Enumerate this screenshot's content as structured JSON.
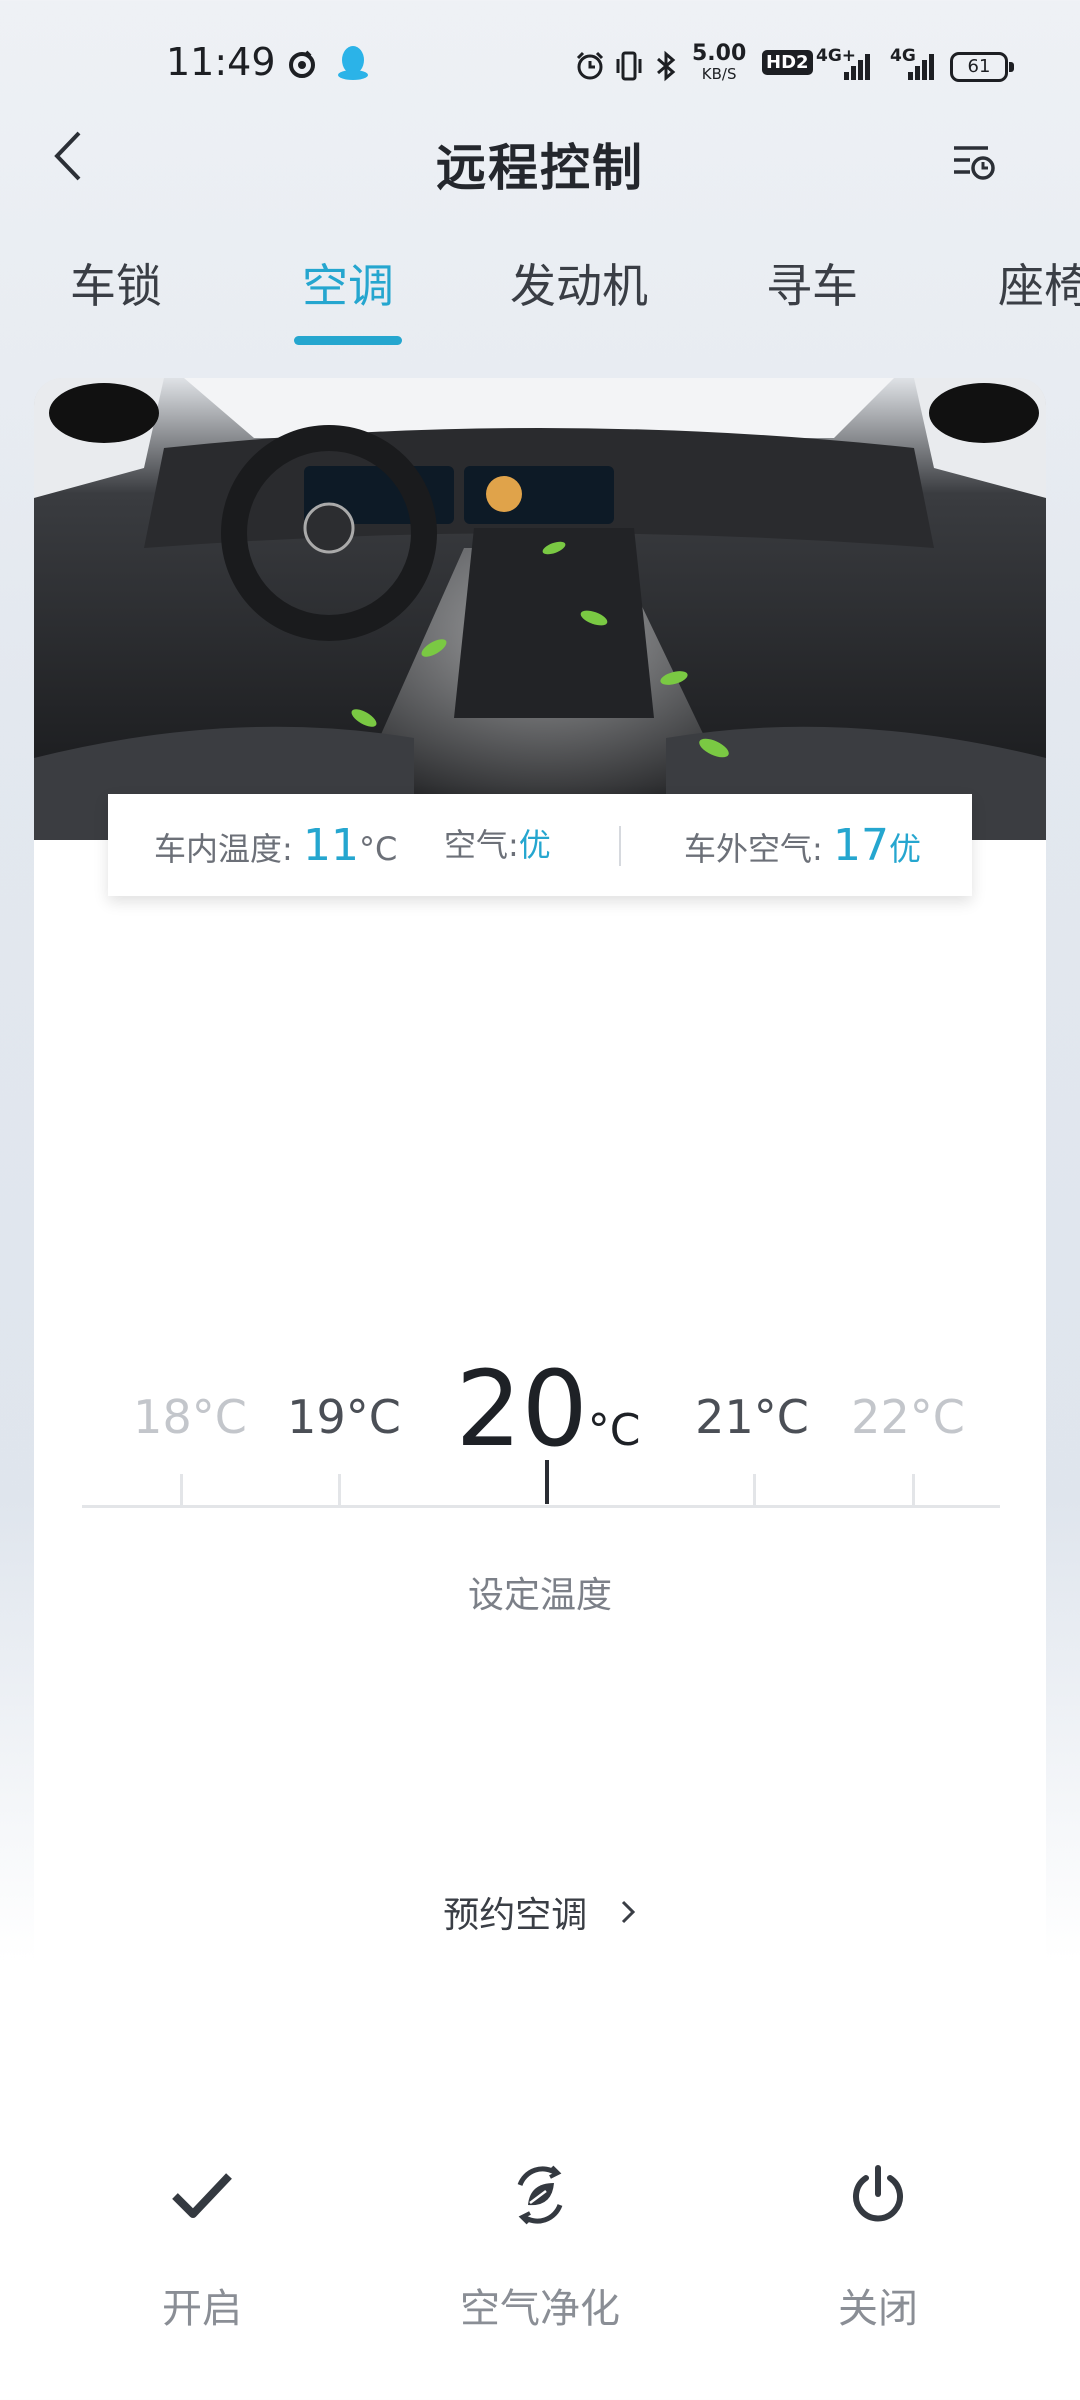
{
  "status_bar": {
    "time": "11:49",
    "net_speed": "5.00",
    "net_speed_unit": "KB/S",
    "hd_badge": "HD2",
    "signal_1": "4G+",
    "signal_2": "4G",
    "battery": "61"
  },
  "header": {
    "title": "远程控制"
  },
  "tabs": [
    {
      "label": "车锁",
      "active": false
    },
    {
      "label": "空调",
      "active": true
    },
    {
      "label": "发动机",
      "active": false
    },
    {
      "label": "寻车",
      "active": false
    },
    {
      "label": "座椅",
      "active": false
    }
  ],
  "info": {
    "inside_label": "车内温度:",
    "inside_value": "11",
    "inside_unit": "°C",
    "air_label": "空气:",
    "air_value": "优",
    "outside_label": "车外空气:",
    "outside_value": "17",
    "outside_grade": "优"
  },
  "temperature": {
    "options": [
      "18°C",
      "19°C",
      "20",
      "21°C",
      "22°C"
    ],
    "current_value": "20",
    "current_unit": "°C",
    "set_label": "设定温度"
  },
  "schedule": {
    "label": "预约空调"
  },
  "actions": [
    {
      "label": "开启",
      "icon": "check-icon"
    },
    {
      "label": "空气净化",
      "icon": "air-purify-icon"
    },
    {
      "label": "关闭",
      "icon": "power-icon"
    }
  ],
  "colors": {
    "accent": "#25a6cf",
    "text_dark": "#24272d",
    "text_muted": "#8a8e95"
  }
}
